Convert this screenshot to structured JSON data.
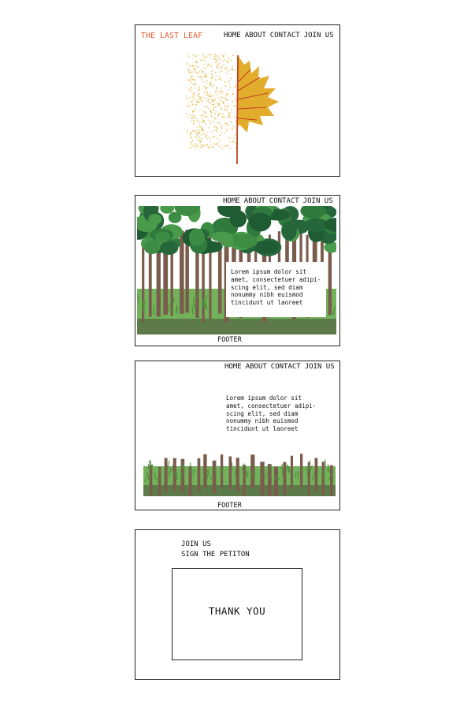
{
  "frame1": {
    "logo": "THE LAST LEAF",
    "nav": [
      "HOME",
      "ABOUT",
      "CONTACT",
      "JOIN US"
    ],
    "colors": {
      "logo": "#e8552b",
      "leaf": "#e2ad2c",
      "vein": "#c0431f"
    }
  },
  "frame2": {
    "nav": [
      "HOME",
      "ABOUT",
      "CONTACT",
      "JOIN US"
    ],
    "lorem": [
      "Lorem ipsum dolor sit",
      "amet, consectetuer adipi-",
      "scing elit, sed diam",
      "nonummy nibh euismod",
      "tincidunt ut laoreet"
    ],
    "footer": "FOOTER"
  },
  "frame3": {
    "nav": [
      "HOME",
      "ABOUT",
      "CONTACT",
      "JOIN US"
    ],
    "lorem": [
      "Lorem ipsum dolor sit",
      "amet, consectetuer adipi-",
      "scing elit, sed diam",
      "nonummy nibh euismod",
      "tincidunt ut laoreet"
    ],
    "footer": "FOOTER"
  },
  "frame4": {
    "join_us": "JOIN US",
    "petition": "SIGN THE PETITON",
    "thank_you": "THANK YOU"
  }
}
